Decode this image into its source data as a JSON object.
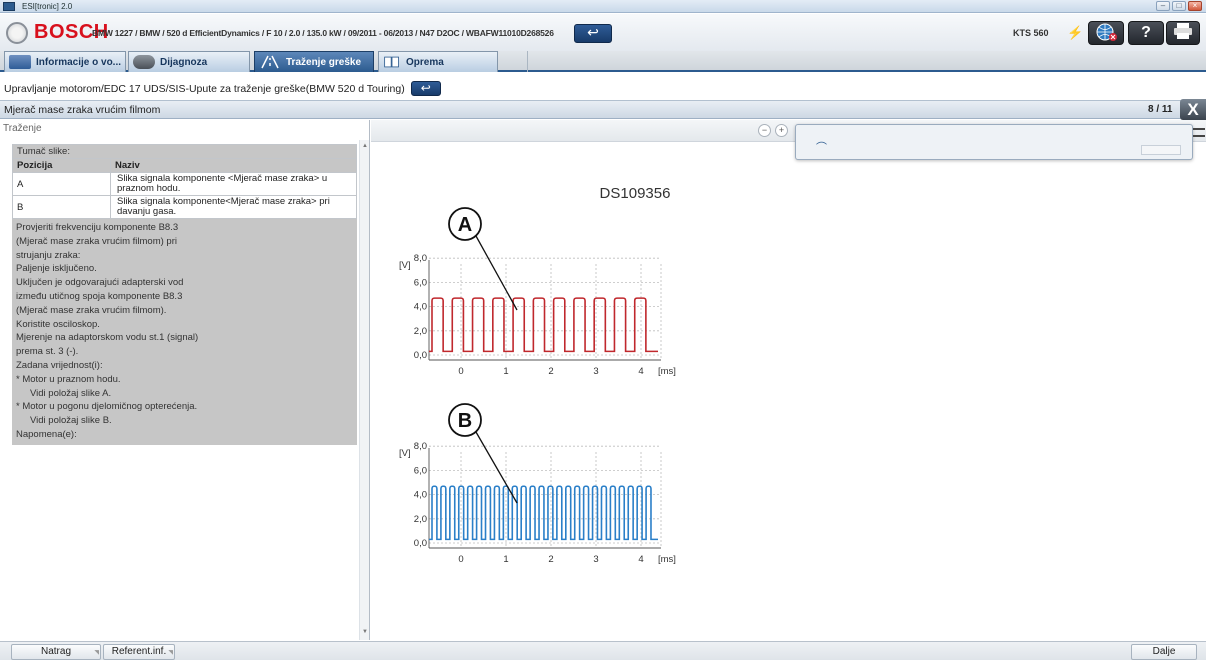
{
  "window": {
    "title": "ESI[tronic] 2.0"
  },
  "header": {
    "brand": "BOSCH",
    "vehicle": "BMW 1227 / BMW / 520 d EfficientDynamics / F 10 / 2.0 / 135.0 kW / 09/2011 - 06/2013 / N47 D2OC / WBAFW11010D268526",
    "device": "KTS 560",
    "help_label": "?"
  },
  "tabs": [
    {
      "label": "Informacije o vo...",
      "active": false
    },
    {
      "label": "Dijagnoza",
      "active": false
    },
    {
      "label": "Traženje greške",
      "active": true
    },
    {
      "label": "Oprema",
      "active": false
    }
  ],
  "breadcrumb": "Upravljanje motorom/EDC 17 UDS/SIS-Upute za traženje greške(BMW 520 d Touring)",
  "page": {
    "title": "Mjerač mase zraka vrućim filmom",
    "counter": "8 / 11",
    "close_label": "X"
  },
  "left": {
    "search_label": "Traženje",
    "legend_title": "Tumač slike:",
    "col_position": "Pozicija",
    "col_name": "Naziv",
    "rows": [
      {
        "pos": "A",
        "name": "Slika signala komponente <Mjerač mase zraka> u praznom hodu."
      },
      {
        "pos": "B",
        "name": "Slika signala komponente<Mjerač mase zraka> pri davanju gasa."
      }
    ],
    "procedure": [
      "Provjeriti frekvenciju komponente B8.3",
      "(Mjerač mase zraka vrućim filmom) pri",
      "strujanju zraka:",
      "Paljenje isključeno.",
      "Uključen je odgovarajući adapterski vod",
      "između utičnog spoja komponente B8.3",
      "(Mjerač mase zraka vrućim filmom).",
      "Koristite osciloskop.",
      "Mjerenje na adaptorskom vodu st.1 (signal)",
      "prema st. 3 (-).",
      "Zadana vrijednost(i):",
      "*  Motor u praznom hodu.",
      "Vidi položaj slike A.",
      "*  Motor u pogonu djelomičnog opterećenja.",
      "Vidi položaj slike B.",
      "Napomena(e):"
    ]
  },
  "diagram": {
    "id": "DS109356",
    "y_ticks": [
      "0,0",
      "2,0",
      "4,0",
      "6,0",
      "8,0"
    ],
    "y_unit": "[V]",
    "x_ticks": [
      "0",
      "1",
      "2",
      "3",
      "4"
    ],
    "x_unit": "[ms]",
    "plots": [
      {
        "label": "A",
        "color": "#c0282d",
        "periods": 11,
        "low": 0.3,
        "high": 4.7
      },
      {
        "label": "B",
        "color": "#2a7fc8",
        "periods": 25,
        "low": 0.3,
        "high": 4.7
      }
    ]
  },
  "bottom": {
    "back": "Natrag",
    "ref": "Referent.inf.",
    "next": "Dalje"
  }
}
